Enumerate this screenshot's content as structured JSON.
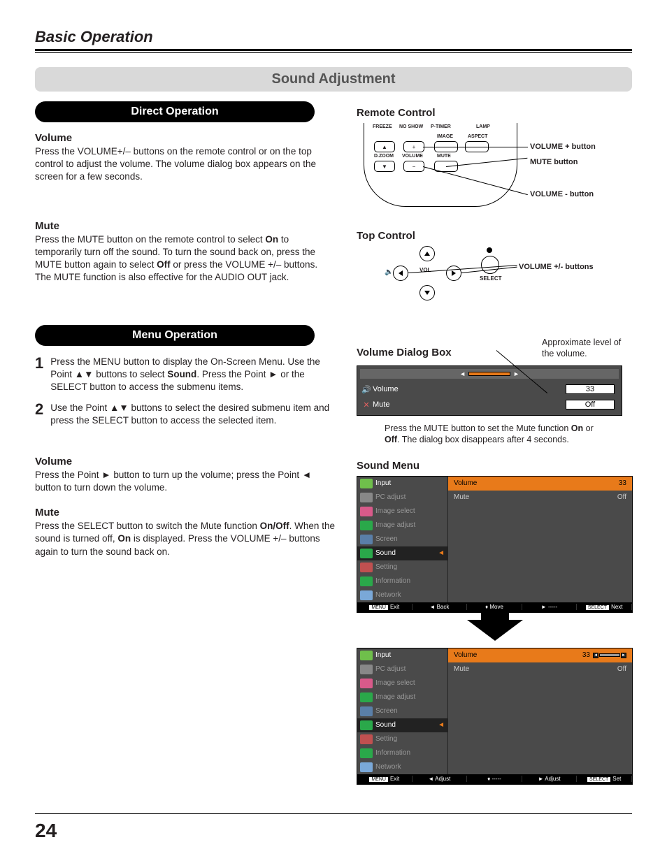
{
  "header": {
    "section": "Basic Operation"
  },
  "main_heading": "Sound Adjustment",
  "pills": {
    "direct": "Direct Operation",
    "menu": "Menu Operation"
  },
  "direct": {
    "volume_h": "Volume",
    "volume_t": "Press the VOLUME+/– buttons on the remote control or on the top control to adjust the volume. The volume dialog box appears on the screen for a few seconds.",
    "mute_h": "Mute",
    "mute_t1": "Press the MUTE button on the remote control to select ",
    "mute_b1": "On",
    "mute_t2": " to temporarily turn off the sound. To turn the sound back on, press the MUTE button again to select ",
    "mute_b2": "Off",
    "mute_t3": " or press the VOLUME +/– buttons. The MUTE function is also effective for the AUDIO OUT jack."
  },
  "menuop": {
    "step1_a": "Press the MENU button to display the On-Screen Menu. Use the Point ▲▼ buttons to select ",
    "step1_b": "Sound",
    "step1_c": ". Press the Point ► or the SELECT button to access the submenu items.",
    "step2": "Use the Point ▲▼ buttons to select the desired submenu item and press the SELECT button to access the selected item.",
    "vol_h": "Volume",
    "vol_t": "Press the Point ► button to turn up the volume; press the Point ◄ button to turn down the volume.",
    "mute_h": "Mute",
    "mute_t1": "Press the SELECT button to switch the Mute function ",
    "mute_b1": "On/Off",
    "mute_t2": ". When the sound is turned off, ",
    "mute_b2": "On",
    "mute_t3": " is displayed. Press the VOLUME +/– buttons again to turn the sound back on."
  },
  "right": {
    "remote_h": "Remote Control",
    "remote_labels": {
      "freeze": "FREEZE",
      "noshow": "NO SHOW",
      "ptimer": "P-TIMER",
      "lamp": "LAMP",
      "image": "IMAGE",
      "aspect": "ASPECT",
      "dzoom": "D.ZOOM",
      "volume": "VOLUME",
      "mute": "MUTE"
    },
    "callouts": {
      "vp": "VOLUME + button",
      "mute": "MUTE button",
      "vm": "VOLUME - button"
    },
    "top_h": "Top Control",
    "top_labels": {
      "select": "SELECT",
      "vol": "VOL"
    },
    "top_callout": "VOLUME +/- buttons",
    "voldlg_h": "Volume Dialog Box",
    "voldlg_note_top": "Approximate level of the volume.",
    "voldlg": {
      "volume_label": "Volume",
      "volume_value": "33",
      "mute_label": "Mute",
      "mute_value": "Off"
    },
    "voldlg_note1": "Press the MUTE button to set the Mute function ",
    "voldlg_note_b1": "On",
    "voldlg_note2": " or ",
    "voldlg_note_b2": "Off",
    "voldlg_note3": ". The dialog box disappears after 4 seconds.",
    "soundmenu_h": "Sound Menu"
  },
  "menu": {
    "items": [
      "Input",
      "PC adjust",
      "Image select",
      "Image adjust",
      "Screen",
      "Sound",
      "Setting",
      "Information",
      "Network"
    ],
    "icon_colors": [
      "#6fbf4b",
      "#888888",
      "#d85a8a",
      "#2aa84a",
      "#5a7fa8",
      "#2aa84a",
      "#c05050",
      "#2aa84a",
      "#7aa8d8"
    ],
    "right_items": [
      {
        "label": "Volume",
        "value": "33"
      },
      {
        "label": "Mute",
        "value": "Off"
      }
    ],
    "foot1": {
      "exit": "Exit",
      "back": "Back",
      "move": "Move",
      "dash": "-----",
      "next": "Next"
    },
    "foot2": {
      "exit": "Exit",
      "adj1": "Adjust",
      "dash": "-----",
      "adj2": "Adjust",
      "set": "Set"
    }
  },
  "page_number": "24"
}
